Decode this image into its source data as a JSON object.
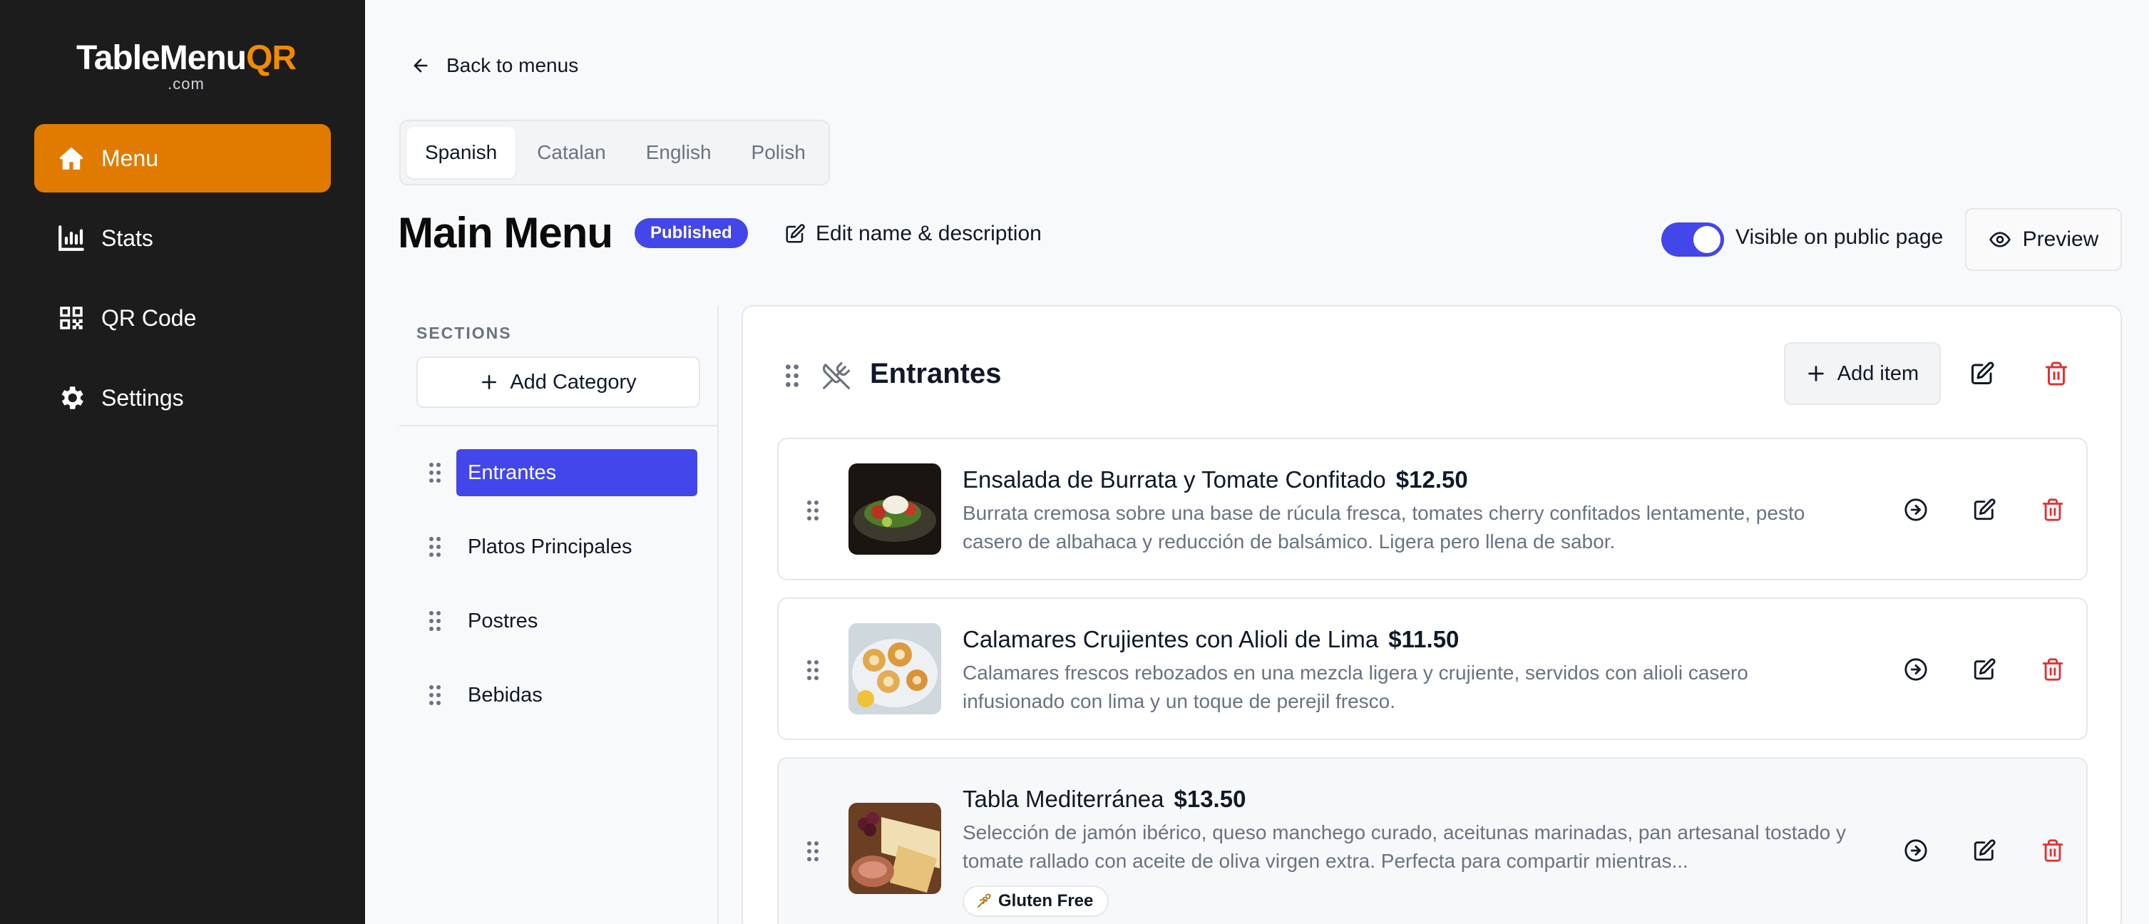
{
  "brand": {
    "name_main": "TableMenu",
    "name_accent": "QR",
    "domain_suffix": ".com",
    "accent_color": "#e07b00"
  },
  "sidebar": {
    "items": [
      {
        "label": "Menu",
        "icon": "home-icon",
        "active": true
      },
      {
        "label": "Stats",
        "icon": "bar-chart-icon",
        "active": false
      },
      {
        "label": "QR Code",
        "icon": "qr-code-icon",
        "active": false
      },
      {
        "label": "Settings",
        "icon": "gear-icon",
        "active": false
      }
    ]
  },
  "header": {
    "back_label": "Back to menus",
    "languages": [
      "Spanish",
      "Catalan",
      "English",
      "Polish"
    ],
    "active_language": "Spanish",
    "menu_title": "Main Menu",
    "status_badge": "Published",
    "edit_label": "Edit name & description",
    "visibility_label": "Visible on public page",
    "visibility_on": true,
    "preview_label": "Preview",
    "primary_color": "#4346e8"
  },
  "sections": {
    "heading": "SECTIONS",
    "add_category_label": "Add Category",
    "categories": [
      "Entrantes",
      "Platos Principales",
      "Postres",
      "Bebidas"
    ],
    "active_category": "Entrantes"
  },
  "category_panel": {
    "title": "Entrantes",
    "icon": "utensils-crossed-icon",
    "add_item_label": "Add item",
    "items": [
      {
        "name": "Ensalada de Burrata y Tomate Confitado",
        "price": "$12.50",
        "description": "Burrata cremosa sobre una base de rúcula fresca, tomates cherry confitados lentamente, pesto casero de albahaca y reducción de balsámico. Ligera pero llena de sabor."
      },
      {
        "name": "Calamares Crujientes con Alioli de Lima",
        "price": "$11.50",
        "description": "Calamares frescos rebozados en una mezcla ligera y crujiente, servidos con alioli casero infusionado con lima y un toque de perejil fresco."
      },
      {
        "name": "Tabla Mediterránea",
        "price": "$13.50",
        "description": "Selección de jamón ibérico, queso manchego curado, aceitunas marinadas, pan artesanal tostado y tomate rallado con aceite de oliva virgen extra. Perfecta para compartir mientras...",
        "tag": "Gluten Free",
        "tag_icon": "wheat-icon"
      }
    ]
  }
}
